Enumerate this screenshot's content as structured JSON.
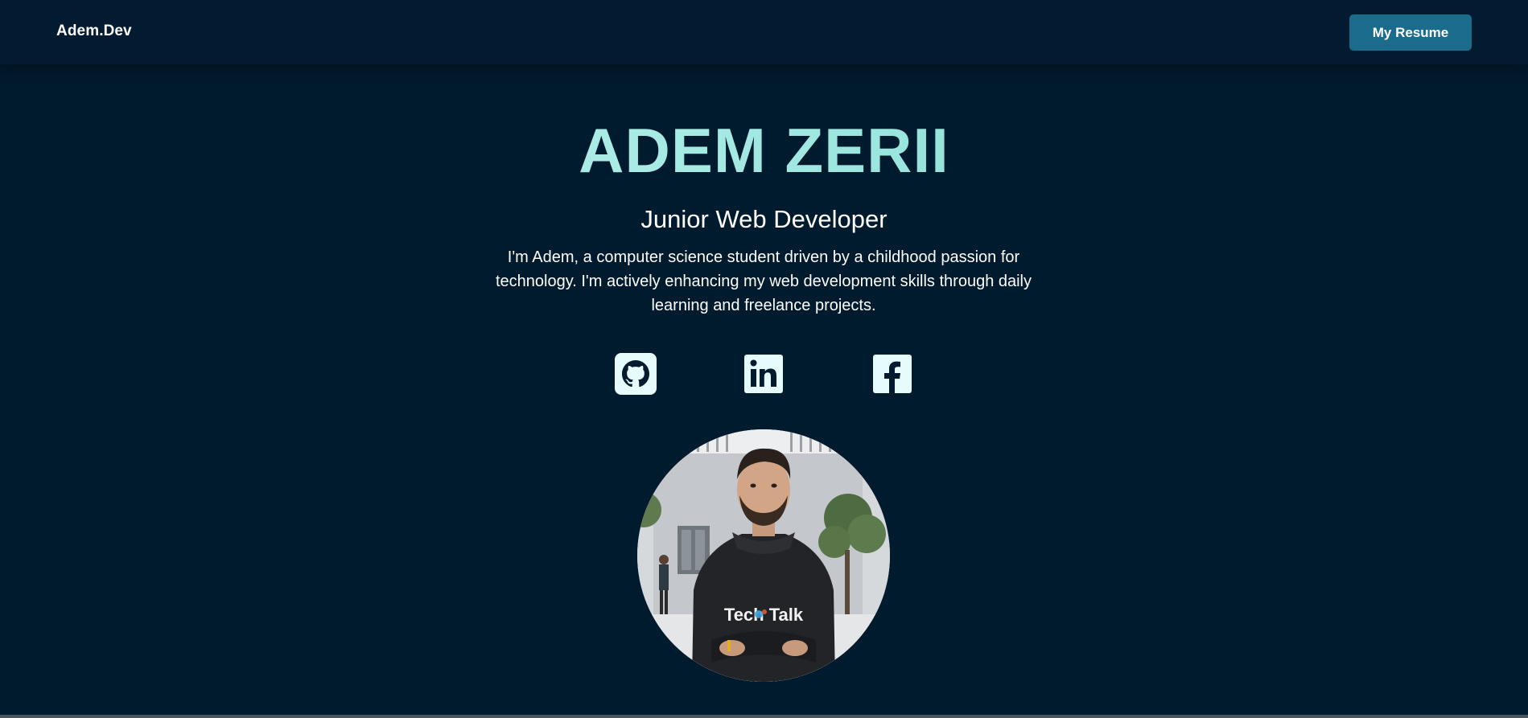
{
  "header": {
    "brand": "Adem.Dev",
    "resume_button": "My Resume"
  },
  "hero": {
    "name": "ADEM ZERII",
    "role": "Junior Web Developer",
    "bio": "I'm Adem, a computer science student driven by a childhood passion for technology. I'm actively enhancing my web development skills through daily learning and freelance projects."
  },
  "social_links": [
    {
      "icon": "github-icon"
    },
    {
      "icon": "linkedin-icon"
    },
    {
      "icon": "facebook-icon"
    }
  ],
  "profile_photo": {
    "hoodie_text": "Tech Talk"
  },
  "colors": {
    "background": "#001a2e",
    "navbar": "#021b30",
    "accent_button": "#1a6b8c",
    "name_gradient_start": "#c9f5f2",
    "name_gradient_end": "#6cd0c8",
    "icon_fill": "#e6fbfb"
  }
}
